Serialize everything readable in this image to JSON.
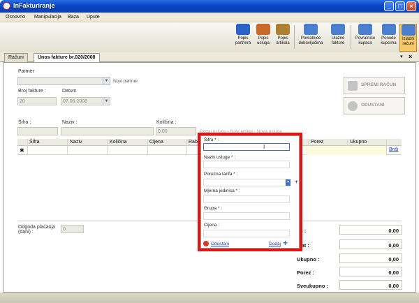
{
  "window": {
    "title": "InFakturiranje"
  },
  "menu": [
    "Osnovno",
    "Manipulacija",
    "Baza",
    "Upute"
  ],
  "toolbar": [
    {
      "line1": "Popis",
      "line2": "partnera",
      "icon": "partners-icon",
      "color": "#2a63c8"
    },
    {
      "line1": "Popis",
      "line2": "usluga",
      "icon": "services-icon",
      "color": "#c86a2a"
    },
    {
      "line1": "Popis",
      "line2": "artikala",
      "icon": "articles-icon",
      "color": "#b08030"
    },
    {
      "line1": "Povratnice",
      "line2": "dobavljačima",
      "icon": "return-suppliers-icon",
      "color": "#4a7fd0"
    },
    {
      "line1": "Ulazne",
      "line2": "fakture",
      "icon": "incoming-invoices-icon",
      "color": "#4a7fd0"
    },
    {
      "line1": "Povratnice",
      "line2": "kupaca",
      "icon": "return-customers-icon",
      "color": "#4a7fd0"
    },
    {
      "line1": "Ponude",
      "line2": "kupcima",
      "icon": "offers-icon",
      "color": "#4a7fd0"
    },
    {
      "line1": "Izlazni",
      "line2": "računi",
      "icon": "outgoing-invoices-icon",
      "color": "#4a7fd0"
    }
  ],
  "tabs": [
    {
      "label": "Računi"
    },
    {
      "label": "Unos fakture br.020/2008"
    }
  ],
  "form": {
    "partner_label": "Partner",
    "novi_partner": "Novi partner",
    "broj_fakture_label": "Broj fakture :",
    "datum_label": "Datum",
    "broj_fakture_value": "20",
    "datum_value": "07.06.2008",
    "sifra_label": "Šifra :",
    "naziv_label": "Naziv :",
    "kolicina_label": "Količina :",
    "kolicina_value": "0,00",
    "hidden_links": "Dodaj uslugu - Novi artikal - Nova usluga"
  },
  "buttons": {
    "spremi": "SPREMI RAČUN",
    "odustani": "ODUSTANI"
  },
  "grid": {
    "columns": [
      "Šifra",
      "Naziv",
      "Količina",
      "Cijena",
      "Rab",
      "Porez",
      "Ukupno"
    ],
    "new_row_marker": "✱",
    "delete_link": "Briši"
  },
  "odgoda": {
    "label_line1": "Odgoda plaćanja",
    "label_line2": "(dani) :",
    "value": "0"
  },
  "totals": [
    {
      "label": "os :",
      "value": "0,00"
    },
    {
      "label": "pat :",
      "value": "0,00"
    },
    {
      "label": "Ukupno :",
      "value": "0,00"
    },
    {
      "label": "Porez :",
      "value": "0,00"
    },
    {
      "label": "Sveukupno :",
      "value": "0,00"
    }
  ],
  "popup": {
    "sifra": "Šifra * :",
    "naziv": "Naziv usluge * :",
    "porezna": "Porezna tarifa * :",
    "jedinica": "Mjerna jedinica * :",
    "grupa": "Grupa * :",
    "cijena": "Cijena :",
    "odustani": "Odustani",
    "dodaj": "Dodaj",
    "plus": "+"
  },
  "colors": {
    "accent": "#0a46c6",
    "highlight": "#e01515",
    "link": "#1a3fc0"
  }
}
